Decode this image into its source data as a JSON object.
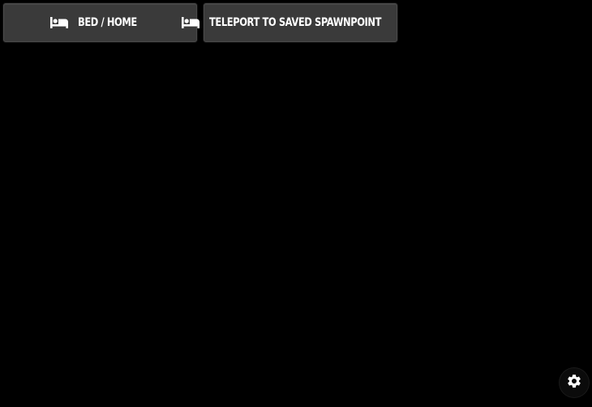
{
  "buttons": [
    {
      "label": "BED / HOME",
      "icon": "bed-icon"
    },
    {
      "label": "TELEPORT TO SAVED SPAWNPOINT",
      "icon": "bed-icon"
    }
  ],
  "settings": {
    "icon": "gear-icon"
  },
  "colors": {
    "background": "#000000",
    "button_bg": "#3a3a3a",
    "button_text": "#ffffff"
  }
}
